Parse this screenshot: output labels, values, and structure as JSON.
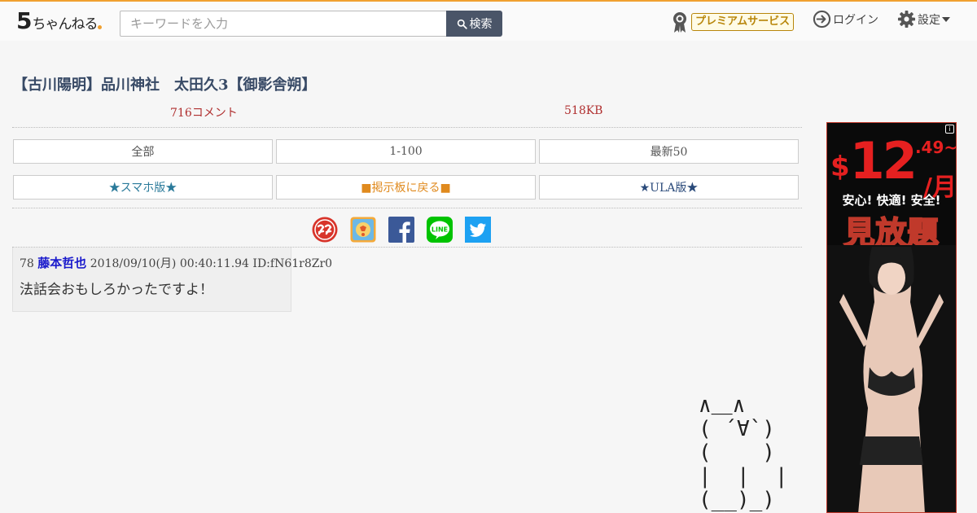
{
  "header": {
    "logo_five": "5",
    "logo_rest": "ちゃんねる",
    "search_placeholder": "キーワードを入力",
    "search_button": "検索",
    "premium_label": "プレミアムサービス",
    "login_label": "ログイン",
    "settings_label": "設定"
  },
  "thread": {
    "title": "【古川陽明】品川神社　太田久3【御影舎朔】",
    "comment_count": "716コメント",
    "size": "518KB"
  },
  "nav": {
    "row1": [
      "全部",
      "1-100",
      "最新50"
    ],
    "row2": [
      "★スマホ版★",
      "■掲示板に戻る■",
      "★ULA版★"
    ]
  },
  "share": [
    "sugoi-icon",
    "tweetdeck-icon",
    "facebook-icon",
    "line-icon",
    "twitter-icon"
  ],
  "post": {
    "number": "78",
    "name": "藤本哲也",
    "date": "2018/09/10(月) 00:40:11.94",
    "id": "ID:fN61r8Zr0",
    "body": "法話会おもしろかったですよ！"
  },
  "ascii_art": "∧＿∧\n( ´∀`)\n(    )\n|  |  |\n(__)_)",
  "ad": {
    "info": "i",
    "currency": "$",
    "price": "12",
    "cents": ".49~",
    "per": "/月",
    "sub": "安心! 快適! 安全!",
    "main": "見放題"
  },
  "colors": {
    "accent": "#f0a030",
    "title": "#384a66",
    "meta": "#b03030",
    "name": "#1a1acc"
  }
}
